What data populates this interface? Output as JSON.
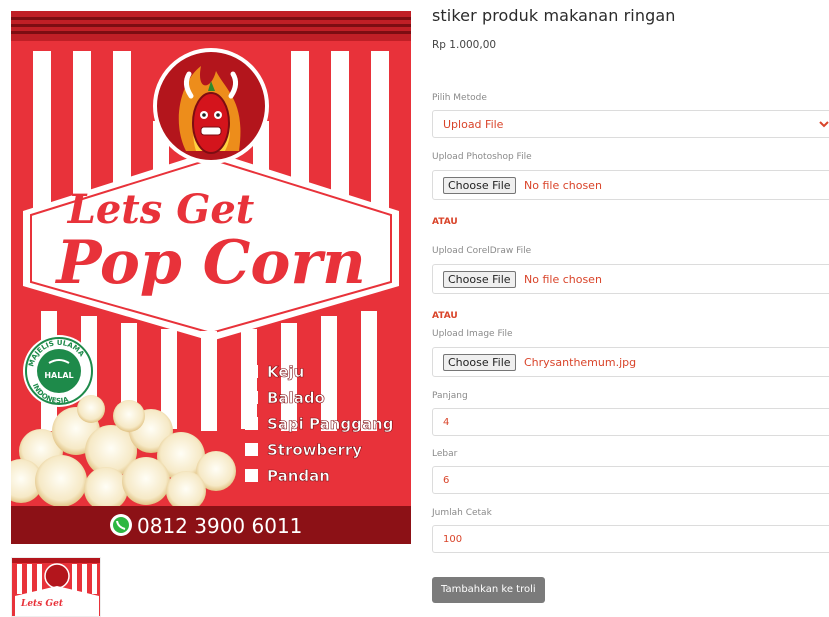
{
  "product": {
    "title": "stiker produk makanan ringan",
    "price": "Rp 1.000,00"
  },
  "poster": {
    "brand_line1": "Lets Get",
    "brand_line2": "Pop Corn",
    "seal_text": "MAJELIS ULAMA INDONESIA",
    "seal_halal": "HALAL",
    "flavors": [
      "Keju",
      "Balado",
      "Sapi Panggang",
      "Strowberry",
      "Pandan"
    ],
    "phone": "0812 3900 6011",
    "thumb_text": "Lets Get",
    "colors": {
      "red": "#e8323a",
      "dark_red": "#b3151c",
      "white": "#ffffff",
      "green": "#1e8a4a"
    }
  },
  "form": {
    "method_label": "Pilih Metode",
    "method_value": "Upload File",
    "photoshop_label": "Upload Photoshop File",
    "photoshop_button": "Choose File",
    "photoshop_file": "No file chosen",
    "atau1": "ATAU",
    "coreldraw_label": "Upload CorelDraw File",
    "coreldraw_button": "Choose File",
    "coreldraw_file": "No file chosen",
    "atau2": "ATAU",
    "image_label": "Upload Image File",
    "image_button": "Choose File",
    "image_file": "Chrysanthemum.jpg",
    "panjang_label": "Panjang",
    "panjang_value": "4",
    "lebar_label": "Lebar",
    "lebar_value": "6",
    "jumlah_label": "Jumlah Cetak",
    "jumlah_value": "100",
    "submit_label": "Tambahkan ke troli"
  },
  "icons": {
    "select_caret": "chevron-down-icon",
    "phone_icon": "whatsapp-icon",
    "seal": "halal-seal-icon"
  }
}
